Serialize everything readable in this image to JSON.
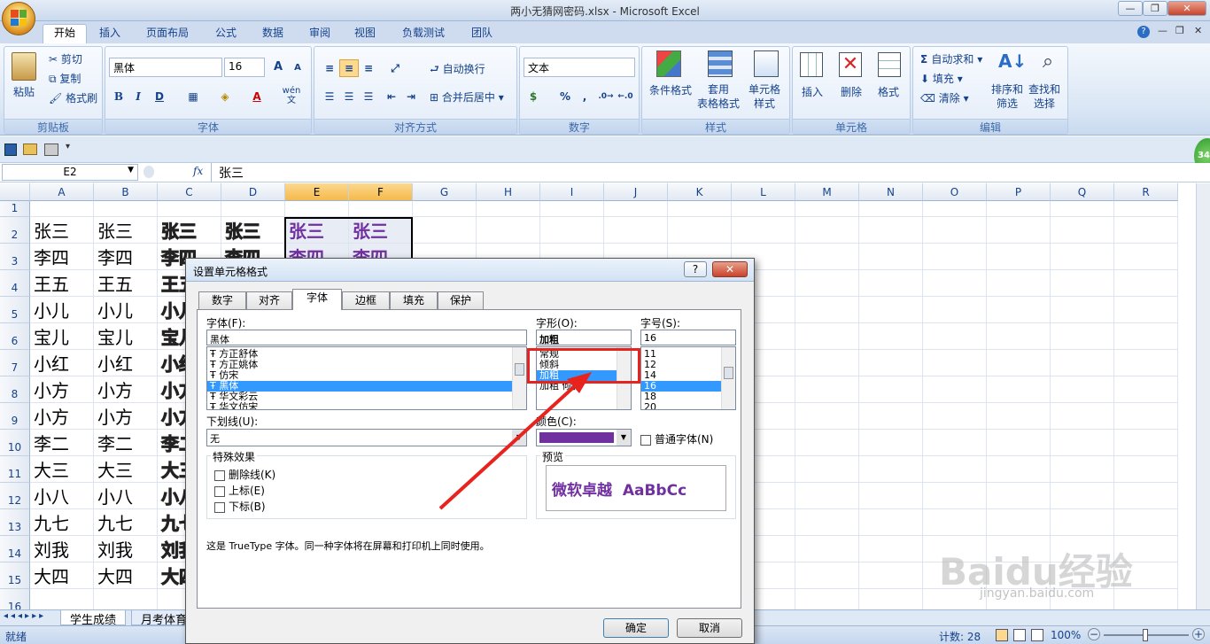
{
  "window": {
    "title": "两小无猜网密码.xlsx - Microsoft Excel",
    "controls": [
      "—",
      "❐",
      "✕"
    ]
  },
  "ribbon_tabs": [
    "开始",
    "插入",
    "页面布局",
    "公式",
    "数据",
    "审阅",
    "视图",
    "负载测试",
    "团队"
  ],
  "ribbon": {
    "clipboard": {
      "label": "剪贴板",
      "paste": "粘贴",
      "cut": "剪切",
      "copy": "复制",
      "format_painter": "格式刷"
    },
    "font": {
      "label": "字体",
      "font_name": "黑体",
      "font_size": "16",
      "bold": "B",
      "italic": "I",
      "underline": "D",
      "grow": "A",
      "shrink": "A",
      "color_a": "A",
      "pinyin": "wén 文"
    },
    "alignment": {
      "label": "对齐方式",
      "wrap": "自动换行",
      "merge": "合并后居中"
    },
    "number": {
      "label": "数字",
      "format": "文本",
      "percent": "%",
      "comma": ","
    },
    "styles": {
      "label": "样式",
      "conditional": "条件格式",
      "table": "套用\n表格格式",
      "cell_styles": "单元格\n样式"
    },
    "cells": {
      "label": "单元格",
      "insert": "插入",
      "delete": "删除",
      "format": "格式"
    },
    "editing": {
      "label": "编辑",
      "autosum": "自动求和",
      "fill": "填充",
      "clear": "清除",
      "sort": "排序和\n筛选",
      "find": "查找和\n选择"
    }
  },
  "formula_bar": {
    "name_box": "E2",
    "fx": "fx",
    "content": "张三"
  },
  "columns": [
    "A",
    "B",
    "C",
    "D",
    "E",
    "F",
    "G",
    "H",
    "I",
    "J",
    "K",
    "L",
    "M",
    "N",
    "O",
    "P",
    "Q",
    "R"
  ],
  "rows": [
    {
      "n": "1",
      "a": "",
      "b": "",
      "c": "",
      "d": "",
      "e": "",
      "f": ""
    },
    {
      "n": "2",
      "a": "张三",
      "b": "张三",
      "c": "张三",
      "d": "张三",
      "e": "张三",
      "f": "张三"
    },
    {
      "n": "3",
      "a": "李四",
      "b": "李四",
      "c": "李四",
      "d": "李四",
      "e": "李四",
      "f": "李四"
    },
    {
      "n": "4",
      "a": "王五",
      "b": "王五",
      "c": "王五",
      "d": "",
      "e": "",
      "f": ""
    },
    {
      "n": "5",
      "a": "小儿",
      "b": "小儿",
      "c": "小儿",
      "d": "",
      "e": "",
      "f": ""
    },
    {
      "n": "6",
      "a": "宝儿",
      "b": "宝儿",
      "c": "宝儿",
      "d": "",
      "e": "",
      "f": ""
    },
    {
      "n": "7",
      "a": "小红",
      "b": "小红",
      "c": "小红",
      "d": "",
      "e": "",
      "f": ""
    },
    {
      "n": "8",
      "a": "小方",
      "b": "小方",
      "c": "小方",
      "d": "",
      "e": "",
      "f": ""
    },
    {
      "n": "9",
      "a": "小方",
      "b": "小方",
      "c": "小方",
      "d": "",
      "e": "",
      "f": ""
    },
    {
      "n": "10",
      "a": "李二",
      "b": "李二",
      "c": "李二",
      "d": "",
      "e": "",
      "f": ""
    },
    {
      "n": "11",
      "a": "大三",
      "b": "大三",
      "c": "大三",
      "d": "",
      "e": "",
      "f": ""
    },
    {
      "n": "12",
      "a": "小八",
      "b": "小八",
      "c": "小八",
      "d": "",
      "e": "",
      "f": ""
    },
    {
      "n": "13",
      "a": "九七",
      "b": "九七",
      "c": "九七",
      "d": "",
      "e": "",
      "f": ""
    },
    {
      "n": "14",
      "a": "刘我",
      "b": "刘我",
      "c": "刘我",
      "d": "",
      "e": "",
      "f": ""
    },
    {
      "n": "15",
      "a": "大四",
      "b": "大四",
      "c": "大四",
      "d": "",
      "e": "",
      "f": ""
    },
    {
      "n": "16",
      "a": "",
      "b": "",
      "c": "",
      "d": "",
      "e": "",
      "f": ""
    }
  ],
  "sheet_tabs": [
    "学生成绩",
    "月考体育"
  ],
  "status": {
    "ready": "就绪",
    "count": "计数: 28",
    "zoom": "100%"
  },
  "dialog": {
    "title": "设置单元格格式",
    "help": "?",
    "close": "✕",
    "tabs": [
      "数字",
      "对齐",
      "字体",
      "边框",
      "填充",
      "保护"
    ],
    "font_label": "字体(F):",
    "font_value": "黑体",
    "font_list": [
      "方正舒体",
      "方正姚体",
      "仿宋",
      "黑体",
      "华文彩云",
      "华文仿宋"
    ],
    "style_label": "字形(O):",
    "style_value": "加粗",
    "style_list": [
      "常规",
      "倾斜",
      "加粗",
      "加粗 倾斜"
    ],
    "size_label": "字号(S):",
    "size_value": "16",
    "size_list": [
      "11",
      "12",
      "14",
      "16",
      "18",
      "20"
    ],
    "underline_label": "下划线(U):",
    "underline_value": "无",
    "color_label": "颜色(C):",
    "color_value": "#7030a0",
    "normal_font": "普通字体(N)",
    "effects_label": "特殊效果",
    "strike": "删除线(K)",
    "superscript": "上标(E)",
    "subscript": "下标(B)",
    "preview_label": "预览",
    "preview_text": "微软卓越  AaBbCc",
    "note": "这是 TrueType 字体。同一种字体将在屏幕和打印机上同时使用。",
    "ok": "确定",
    "cancel": "取消"
  },
  "watermark": {
    "brand": "Baidu经验",
    "url": "jingyan.baidu.com"
  }
}
